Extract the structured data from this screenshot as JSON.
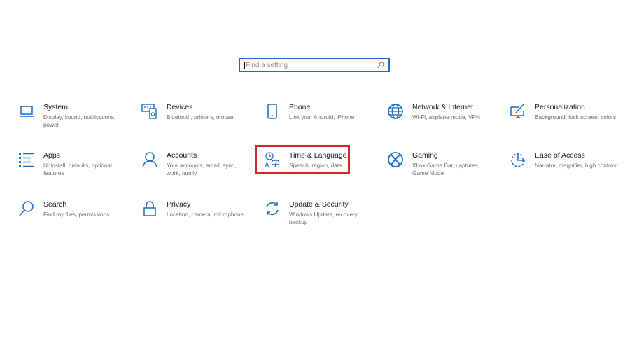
{
  "search": {
    "placeholder": "Find a setting",
    "icon": "search-icon"
  },
  "accent_color": "#1b6dc1",
  "highlight_color": "#d9212a",
  "tiles": [
    {
      "title": "System",
      "desc": "Display, sound, notifications, power",
      "icon": "laptop-icon"
    },
    {
      "title": "Devices",
      "desc": "Bluetooth, printers, mouse",
      "icon": "devices-icon"
    },
    {
      "title": "Phone",
      "desc": "Link your Android, iPhone",
      "icon": "phone-icon"
    },
    {
      "title": "Network & Internet",
      "desc": "Wi-Fi, airplane mode, VPN",
      "icon": "globe-icon"
    },
    {
      "title": "Personalization",
      "desc": "Background, lock screen, colors",
      "icon": "paintbrush-icon"
    },
    {
      "title": "Apps",
      "desc": "Uninstall, defaults, optional features",
      "icon": "apps-list-icon"
    },
    {
      "title": "Accounts",
      "desc": "Your accounts, email, sync, work, family",
      "icon": "person-icon"
    },
    {
      "title": "Time & Language",
      "desc": "Speech, region, date",
      "icon": "time-language-icon",
      "highlighted": true
    },
    {
      "title": "Gaming",
      "desc": "Xbox Game Bar, captures, Game Mode",
      "icon": "xbox-icon"
    },
    {
      "title": "Ease of Access",
      "desc": "Narrator, magnifier, high contrast",
      "icon": "ease-of-access-icon"
    },
    {
      "title": "Search",
      "desc": "Find my files, permissions",
      "icon": "search-icon"
    },
    {
      "title": "Privacy",
      "desc": "Location, camera, microphone",
      "icon": "lock-icon"
    },
    {
      "title": "Update & Security",
      "desc": "Windows Update, recovery, backup",
      "icon": "sync-icon"
    }
  ]
}
